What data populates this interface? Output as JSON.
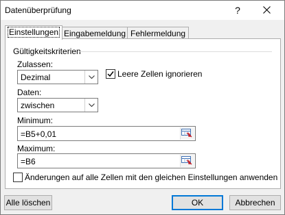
{
  "window": {
    "title": "Datenüberprüfung",
    "help_glyph": "?"
  },
  "tabs": [
    {
      "label": "Einstellungen",
      "active": true
    },
    {
      "label": "Eingabemeldung",
      "active": false
    },
    {
      "label": "Fehlermeldung",
      "active": false
    }
  ],
  "criteria": {
    "group_title": "Gültigkeitskriterien",
    "allow_label": "Zulassen:",
    "allow_value": "Dezimal",
    "ignore_blank_label": "Leere Zellen ignorieren",
    "ignore_blank_checked": true,
    "data_label": "Daten:",
    "data_value": "zwischen",
    "minimum_label": "Minimum:",
    "minimum_value": "=B5+0,01",
    "maximum_label": "Maximum:",
    "maximum_value": "=B6"
  },
  "apply_all": {
    "label": "Änderungen auf alle Zellen mit den gleichen Einstellungen anwenden",
    "checked": false
  },
  "buttons": {
    "clear_all": "Alle löschen",
    "ok": "OK",
    "cancel": "Abbrechen"
  }
}
